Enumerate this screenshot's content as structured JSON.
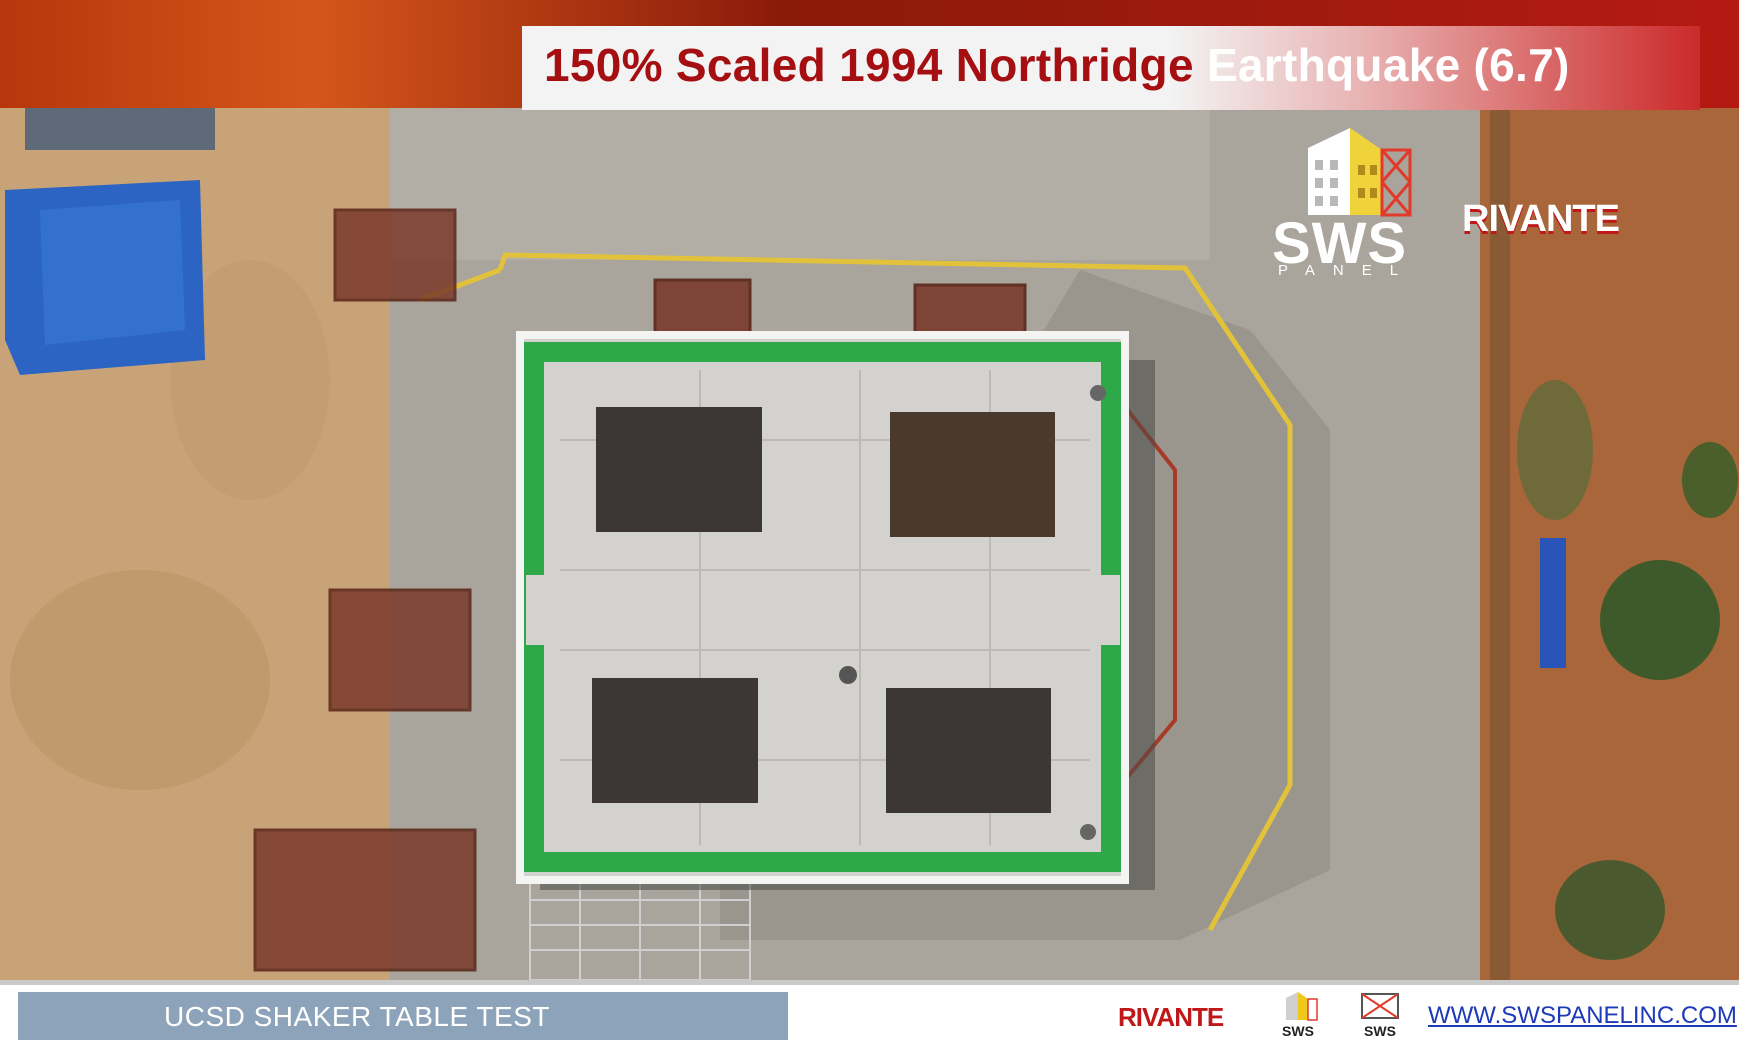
{
  "title": {
    "part1": "150% Scaled 1994 Northridge",
    "part2": "Earthquake (6.7)"
  },
  "logos": {
    "sws_word": "SWS",
    "sws_sub": "PANEL",
    "rivante": "RIVANTE"
  },
  "caption": "UCSD SHAKER TABLE TEST",
  "footer": {
    "rivante": "RIVANTE",
    "url": "WWW.SWSPANELINC.COM"
  },
  "colors": {
    "title_red": "#a50f12",
    "panel_green": "#2fa84a",
    "caption_bg": "#8da3b9",
    "link_blue": "#1d3ab8"
  }
}
